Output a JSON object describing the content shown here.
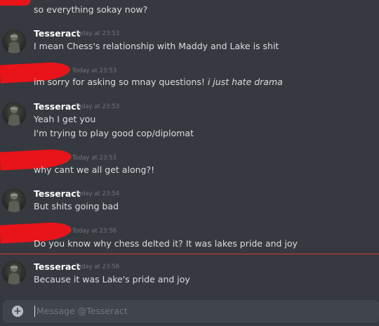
{
  "messages": [
    {
      "kind": "cont",
      "author": "",
      "time": "",
      "lines": [
        "so everything sokay now?"
      ]
    },
    {
      "kind": "tess",
      "author": "Tesseract",
      "time": "Today at 23:53",
      "lines": [
        "I mean Chess's relationship with Maddy and Lake is shit"
      ]
    },
    {
      "kind": "red",
      "author": "",
      "time": "Today at 23:53",
      "line_plain": "im sorry for asking so mnay questions! ",
      "line_italic": "i just hate drama"
    },
    {
      "kind": "tess",
      "author": "Tesseract",
      "time": "Today at 23:53",
      "lines": [
        "Yeah I get you",
        "I'm trying to play good cop/diplomat"
      ]
    },
    {
      "kind": "red",
      "author": "",
      "time": "Today at 23:53",
      "line_plain": "why cant we all get along?!",
      "line_italic": ""
    },
    {
      "kind": "tess",
      "author": "Tesseract",
      "time": "Today at 23:54",
      "lines": [
        "But shits going bad"
      ]
    },
    {
      "kind": "red",
      "author": "",
      "time": "Today at 23:56",
      "line_plain": "Do you know why chess delted it? It was lakes pride and joy",
      "line_italic": ""
    },
    {
      "kind": "tess",
      "author": "Tesseract",
      "time": "Today at 23:56",
      "lines": [
        "Because it was Lake's pride and joy"
      ]
    }
  ],
  "composer": {
    "placeholder": "Message @Tesseract",
    "add_icon": "plus-circle-icon"
  },
  "colors": {
    "background": "#36393f",
    "redaction": "#e8141a",
    "divider": "#d23a3a"
  }
}
